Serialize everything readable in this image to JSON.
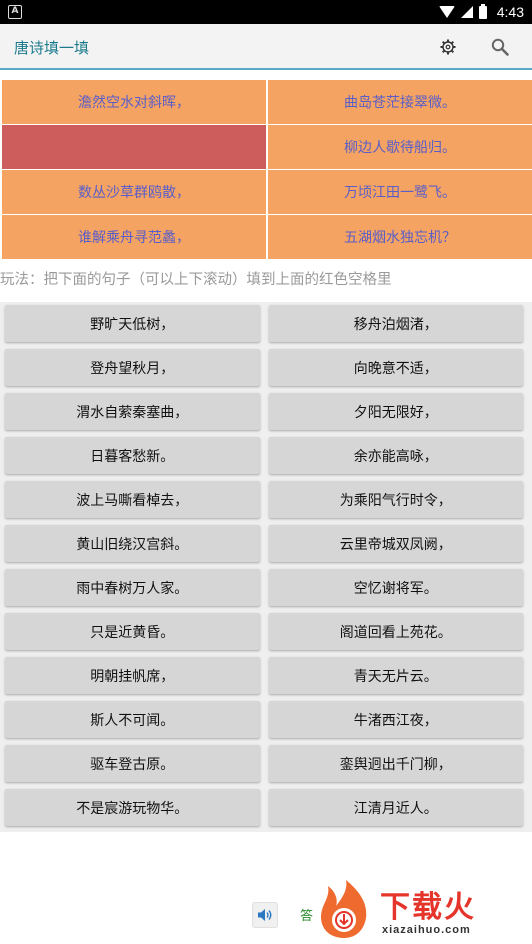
{
  "status_bar": {
    "time": "4:43",
    "notification_glyph": "A"
  },
  "app_bar": {
    "title": "唐诗填一填",
    "icons": [
      "gear-icon",
      "search-icon"
    ]
  },
  "poem": {
    "rows": [
      [
        "澹然空水对斜晖，",
        "曲岛苍茫接翠微。"
      ],
      [
        "",
        "柳边人歇待船归。"
      ],
      [
        "数丛沙草群鸥散，",
        "万顷江田一鹭飞。"
      ],
      [
        "谁解乘舟寻范蠡，",
        "五湖烟水独忘机？"
      ]
    ],
    "blank_color": "#cd5c5c",
    "cell_color": "#f4a362",
    "text_color": "#5a5ec8"
  },
  "instruction": "玩法：把下面的句子（可以上下滚动）填到上面的红色空格里",
  "choices": [
    [
      "野旷天低树，",
      "移舟泊烟渚，"
    ],
    [
      "登舟望秋月，",
      "向晚意不适，"
    ],
    [
      "渭水自萦秦塞曲，",
      "夕阳无限好，"
    ],
    [
      "日暮客愁新。",
      "余亦能高咏，"
    ],
    [
      "波上马嘶看棹去，",
      "为乘阳气行时令，"
    ],
    [
      "黄山旧绕汉宫斜。",
      "云里帝城双凤阙，"
    ],
    [
      "雨中春树万人家。",
      "空忆谢将军。"
    ],
    [
      "只是近黄昏。",
      "阁道回看上苑花。"
    ],
    [
      "明朝挂帆席，",
      "青天无片云。"
    ],
    [
      "斯人不可闻。",
      "牛渚西江夜，"
    ],
    [
      "驱车登古原。",
      "銮舆迥出千门柳，"
    ],
    [
      "不是宸游玩物华。",
      "江清月近人。"
    ]
  ],
  "bottom": {
    "answer_label": "答",
    "sound_icon": "speaker-icon"
  },
  "watermark": {
    "text": "下载火",
    "url": "xiazaihuo.com"
  }
}
